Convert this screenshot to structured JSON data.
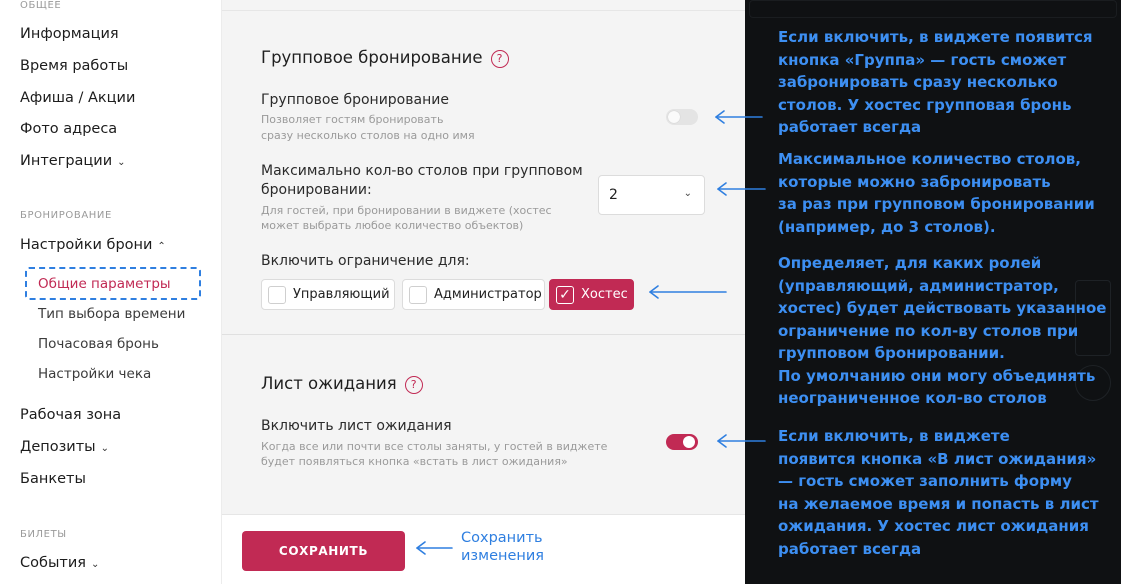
{
  "sidebar": {
    "general_section": "ОБЩЕЕ",
    "general_items": [
      {
        "label": "Информация"
      },
      {
        "label": "Время работы"
      },
      {
        "label": "Афиша / Акции"
      },
      {
        "label": "Фото адреса"
      },
      {
        "label": "Интеграции",
        "chevron": "⌄"
      }
    ],
    "booking_section": "БРОНИРОВАНИЕ",
    "booking_parent": {
      "label": "Настройки брони",
      "chevron": "⌃"
    },
    "booking_sub": [
      {
        "label": "Общие параметры",
        "active": true
      },
      {
        "label": "Тип выбора времени"
      },
      {
        "label": "Почасовая бронь"
      },
      {
        "label": "Настройки чека"
      }
    ],
    "other_items": [
      {
        "label": "Рабочая зона"
      },
      {
        "label": "Депозиты",
        "chevron": "⌄"
      },
      {
        "label": "Банкеты"
      }
    ],
    "tickets_section": "БИЛЕТЫ",
    "tickets_items": [
      {
        "label": "События",
        "chevron": "⌄"
      }
    ]
  },
  "group_booking": {
    "title": "Групповое бронирование",
    "help": "?",
    "toggle_label": "Групповое бронирование",
    "toggle_desc_1": "Позволяет гостям бронировать",
    "toggle_desc_2": "сразу несколько столов на одно имя",
    "toggle_on": false,
    "max_label_1": "Максимально кол-во столов при групповом",
    "max_label_2": "бронировании:",
    "max_desc_1": "Для гостей, при бронировании в виджете (хостес",
    "max_desc_2": "может выбрать любое количество объектов)",
    "max_value": "2",
    "limit_label": "Включить ограничение для:",
    "roles": [
      {
        "label": "Управляющий",
        "checked": false
      },
      {
        "label": "Администратор",
        "checked": false
      },
      {
        "label": "Хостес",
        "checked": true
      }
    ]
  },
  "waitlist": {
    "title": "Лист ожидания",
    "help": "?",
    "toggle_label": "Включить лист ожидания",
    "desc_1": "Когда все или почти все столы заняты, у гостей в виджете",
    "desc_2": "будет появляться кнопка «встать в лист ожидания»",
    "toggle_on": true
  },
  "footer": {
    "save_label": "СОХРАНИТЬ",
    "note_1": "Сохранить",
    "note_2": "изменения"
  },
  "explanations": {
    "e1": [
      "Если включить, в виджете появится",
      "кнопка «Группа» — гость сможет",
      "забронировать сразу несколько",
      "столов. У хостес групповая бронь",
      "работает всегда"
    ],
    "e2": [
      "Максимальное количество столов,",
      "которые можно забронировать",
      "за раз при групповом бронировании",
      "(например, до 3 столов)."
    ],
    "e3": [
      "Определяет, для каких ролей",
      "(управляющий, администратор,",
      "хостес) будет действовать указанное",
      "ограничение по кол-ву столов при",
      "групповом бронировании.",
      "По умолчанию они могу объединять",
      "неограниченное кол-во столов"
    ],
    "e4": [
      "Если включить, в виджете",
      "появится кнопка «В лист ожидания»",
      "— гость сможет заполнить форму",
      "на желаемое время и попасть в лист",
      "ожидания. У хостес лист ожидания",
      "работает всегда"
    ]
  },
  "colors": {
    "accent": "#c12a54",
    "annotation_blue": "#2f7fe0",
    "explain_blue": "#3d8ff2",
    "dark_bg": "#0f1113"
  }
}
